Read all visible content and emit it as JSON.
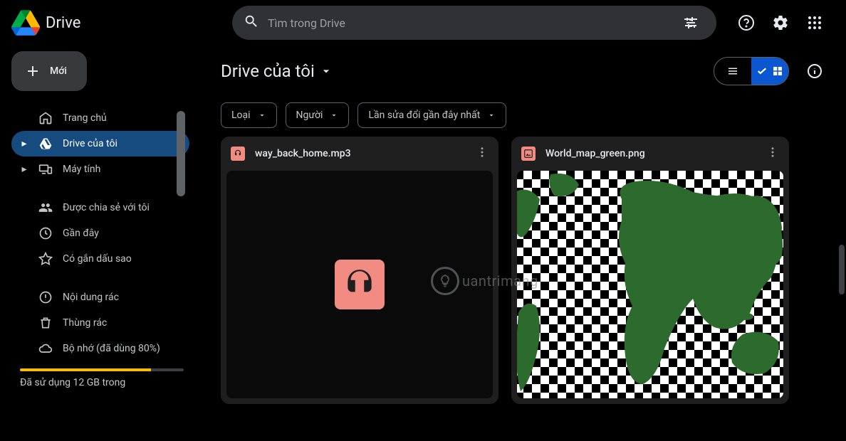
{
  "header": {
    "appName": "Drive",
    "searchPlaceholder": "Tìm trong Drive"
  },
  "sidebar": {
    "newButtonLabel": "Mới",
    "items": [
      {
        "label": "Trang chủ",
        "icon": "home",
        "expandable": false,
        "active": false
      },
      {
        "label": "Drive của tôi",
        "icon": "drive",
        "expandable": true,
        "active": true
      },
      {
        "label": "Máy tính",
        "icon": "devices",
        "expandable": true,
        "active": false
      }
    ],
    "itemsB": [
      {
        "label": "Được chia sẻ với tôi",
        "icon": "shared"
      },
      {
        "label": "Gần đây",
        "icon": "clock"
      },
      {
        "label": "Có gắn dấu sao",
        "icon": "star"
      }
    ],
    "itemsC": [
      {
        "label": "Nội dung rác",
        "icon": "spam"
      },
      {
        "label": "Thùng rác",
        "icon": "trash"
      },
      {
        "label": "Bộ nhớ (đã dùng 80%)",
        "icon": "cloud"
      }
    ],
    "storagePercent": 80,
    "storageText": "Đã sử dụng 12 GB trong"
  },
  "main": {
    "title": "Drive của tôi",
    "filters": [
      {
        "label": "Loại"
      },
      {
        "label": "Người"
      },
      {
        "label": "Lần sửa đổi gần đây nhất"
      }
    ],
    "files": [
      {
        "name": "way_back_home.mp3",
        "type": "audio"
      },
      {
        "name": "World_map_green.png",
        "type": "image"
      }
    ]
  },
  "watermark": "uantrimang"
}
